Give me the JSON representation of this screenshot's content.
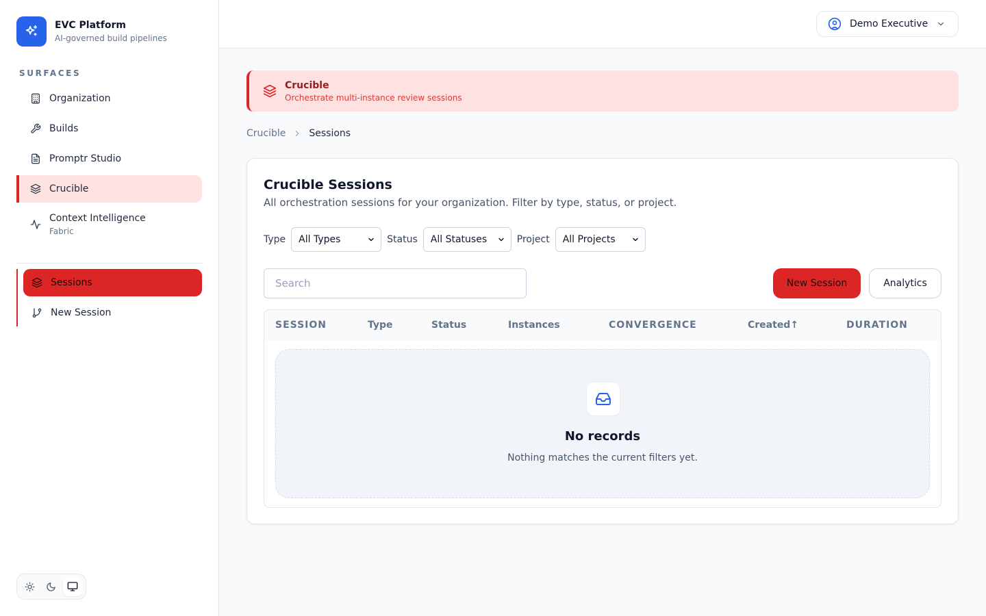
{
  "brand": {
    "title": "EVC Platform",
    "subtitle": "AI-governed build pipelines"
  },
  "sidebar": {
    "section_label": "SURFACES",
    "items": [
      {
        "label": "Organization",
        "icon": "building-icon"
      },
      {
        "label": "Builds",
        "icon": "wrench-icon"
      },
      {
        "label": "Promptr Studio",
        "icon": "document-icon"
      },
      {
        "label": "Crucible",
        "icon": "layers-icon",
        "active": true
      },
      {
        "label": "Context Intelligence",
        "sublabel": "Fabric",
        "icon": "activity-icon"
      }
    ],
    "subitems": [
      {
        "label": "Sessions",
        "icon": "layers-icon",
        "active": true
      },
      {
        "label": "New Session",
        "icon": "git-branch-icon"
      }
    ],
    "theme_options": [
      "light",
      "dark",
      "system"
    ],
    "theme_selected": "system"
  },
  "topbar": {
    "user_label": "Demo Executive"
  },
  "banner": {
    "title": "Crucible",
    "subtitle": "Orchestrate multi-instance review sessions"
  },
  "breadcrumb": {
    "parent": "Crucible",
    "current": "Sessions"
  },
  "card": {
    "title": "Crucible Sessions",
    "description": "All orchestration sessions for your organization. Filter by type, status, or project."
  },
  "filters": {
    "type_label": "Type",
    "type_value": "All Types",
    "status_label": "Status",
    "status_value": "All Statuses",
    "project_label": "Project",
    "project_value": "All Projects"
  },
  "search": {
    "placeholder": "Search",
    "value": ""
  },
  "actions": {
    "new_session": "New Session",
    "analytics": "Analytics"
  },
  "table": {
    "columns": [
      "SESSION",
      "Type",
      "Status",
      "Instances",
      "CONVERGENCE",
      "Created↑",
      "DURATION"
    ],
    "rows": []
  },
  "empty_state": {
    "title": "No records",
    "subtitle": "Nothing matches the current filters yet."
  },
  "colors": {
    "accent": "#dc2626",
    "accent_soft": "#fee2e2",
    "brand": "#2563eb"
  }
}
